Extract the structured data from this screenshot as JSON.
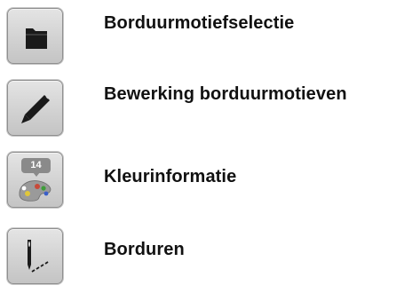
{
  "menu": {
    "items": [
      {
        "icon": "folder-icon",
        "label": "Borduurmotiefselectie"
      },
      {
        "icon": "pencil-icon",
        "label": "Bewerking borduurmotieven"
      },
      {
        "icon": "palette-icon",
        "label": "Kleurinformatie",
        "badge": "14"
      },
      {
        "icon": "needle-stitch-icon",
        "label": "Borduren"
      }
    ]
  }
}
